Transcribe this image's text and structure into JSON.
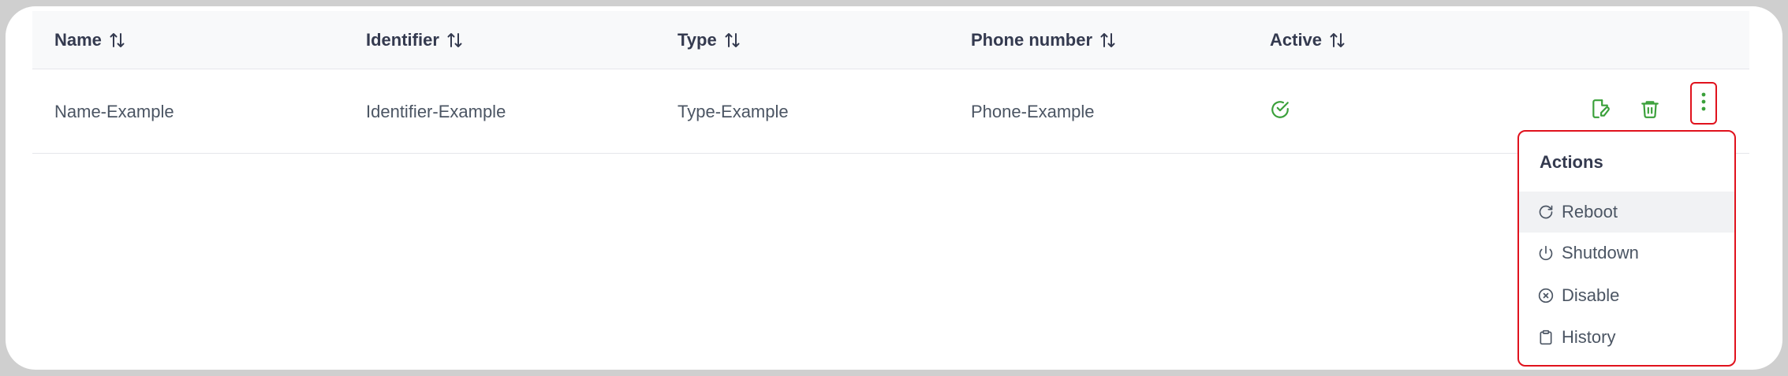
{
  "table": {
    "columns": [
      {
        "label": "Name"
      },
      {
        "label": "Identifier"
      },
      {
        "label": "Type"
      },
      {
        "label": "Phone number"
      },
      {
        "label": "Active"
      }
    ],
    "rows": [
      {
        "name": "Name-Example",
        "identifier": "Identifier-Example",
        "type": "Type-Example",
        "phone": "Phone-Example",
        "active": true
      }
    ]
  },
  "row_actions": {
    "edit_icon": "edit-icon",
    "delete_icon": "trash-icon",
    "more_icon": "more-vertical-icon"
  },
  "dropdown": {
    "title": "Actions",
    "items": [
      {
        "label": "Reboot",
        "icon": "reboot-icon"
      },
      {
        "label": "Shutdown",
        "icon": "power-icon"
      },
      {
        "label": "Disable",
        "icon": "disable-icon"
      },
      {
        "label": "History",
        "icon": "clipboard-icon"
      }
    ]
  },
  "colors": {
    "accent_green": "#3aa03a",
    "highlight_red": "#e0121d",
    "header_bg": "#f8f9fa",
    "text_dark": "#343a4f",
    "text_body": "#4b5563"
  }
}
